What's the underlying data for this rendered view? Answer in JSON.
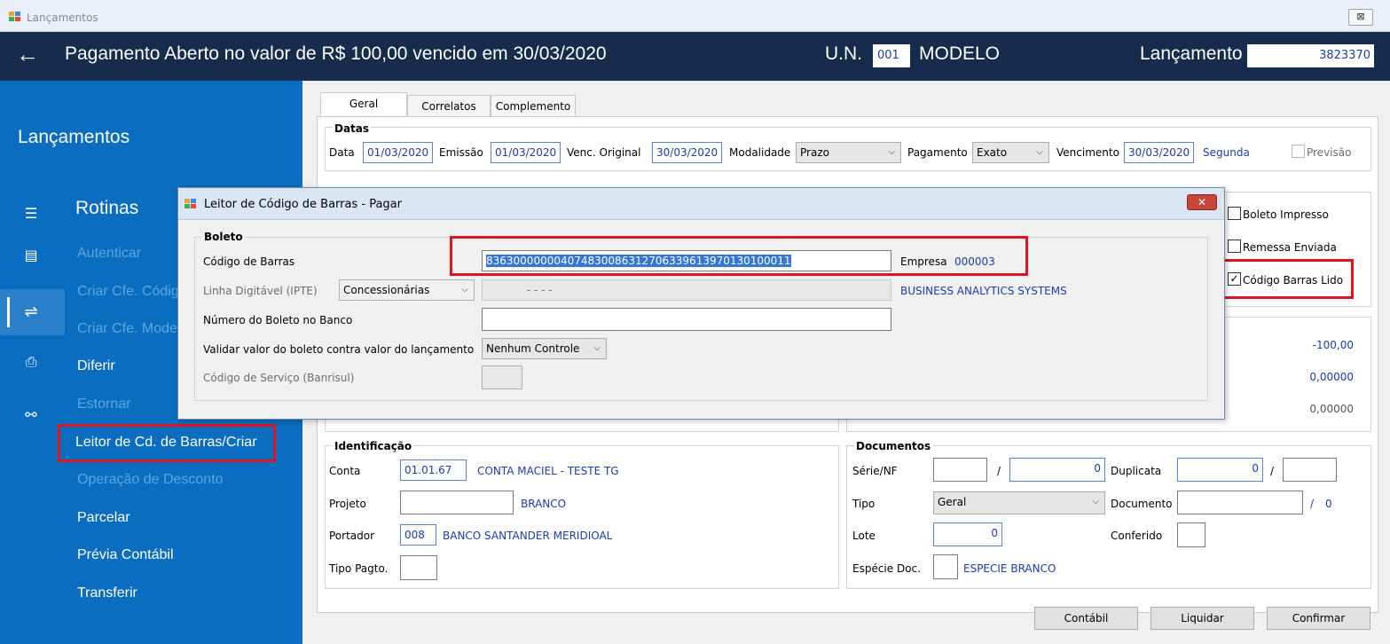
{
  "window": {
    "title": "Lançamentos",
    "close_symbol": "⊠"
  },
  "header": {
    "back_symbol": "←",
    "title": "Pagamento Aberto no valor de R$ 100,00 vencido em 30/03/2020",
    "un_label": "U.N.",
    "un_code": "001",
    "un_name": "MODELO",
    "lancamento_label": "Lançamento",
    "lancamento_value": "3823370"
  },
  "sidebar": {
    "heading": "Lançamentos",
    "rotinas_label": "Rotinas",
    "items": [
      {
        "label": "Autenticar",
        "enabled": false
      },
      {
        "label": "Criar Cfe. Códig",
        "enabled": false
      },
      {
        "label": "Criar Cfe. Mode",
        "enabled": false
      },
      {
        "label": "Diferir",
        "enabled": true
      },
      {
        "label": "Estornar",
        "enabled": false
      },
      {
        "label": "Leitor de Cd. de Barras/Criar",
        "enabled": true
      },
      {
        "label": "Operação de Desconto",
        "enabled": false
      },
      {
        "label": "Parcelar",
        "enabled": true
      },
      {
        "label": "Prévia Contábil",
        "enabled": true
      },
      {
        "label": "Transferir",
        "enabled": true
      }
    ],
    "icons": [
      "menu-icon",
      "document-icon",
      "transfer-icon",
      "printer-icon",
      "tree-icon"
    ]
  },
  "tabs": [
    "Geral",
    "Correlatos",
    "Complemento"
  ],
  "datas": {
    "legend": "Datas",
    "data_label": "Data",
    "data_value": "01/03/2020",
    "emissao_label": "Emissão",
    "emissao_value": "01/03/2020",
    "venc_original_label": "Venc. Original",
    "venc_original_value": "30/03/2020",
    "modalidade_label": "Modalidade",
    "modalidade_value": "Prazo",
    "pagamento_label": "Pagamento",
    "pagamento_value": "Exato",
    "vencimento_label": "Vencimento",
    "vencimento_value": "30/03/2020",
    "weekday": "Segunda",
    "previsao_label": "Previsão"
  },
  "flags": {
    "boleto_impresso": "Boleto Impresso",
    "remessa_enviada": "Remessa Enviada",
    "codigo_barras_lido": "Código Barras Lido"
  },
  "valores": [
    "-100,00",
    "0,00000",
    "0,00000"
  ],
  "identificacao": {
    "legend": "Identificação",
    "conta_label": "Conta",
    "conta_value": "01.01.67",
    "conta_name": "CONTA MACIEL - TESTE TG",
    "projeto_label": "Projeto",
    "projeto_name": "BRANCO",
    "portador_label": "Portador",
    "portador_value": "008",
    "portador_name": "BANCO SANTANDER MERIDIOAL",
    "tipo_pagto_label": "Tipo Pagto."
  },
  "documentos": {
    "legend": "Documentos",
    "serie_label": "Série/NF",
    "slash": "/",
    "nf_value": "0",
    "duplicata_label": "Duplicata",
    "duplicata_value": "0",
    "tipo_label": "Tipo",
    "tipo_value": "Geral",
    "documento_label": "Documento",
    "documento_suffix": "/",
    "documento_suffix_value": "0",
    "lote_label": "Lote",
    "lote_value": "0",
    "conferido_label": "Conferido",
    "especie_label": "Espécie Doc.",
    "especie_name": "ESPECIE BRANCO"
  },
  "buttons": {
    "contabil": "Contábil",
    "liquidar": "Liquidar",
    "confirmar": "Confirmar"
  },
  "dialog": {
    "title": "Leitor de Código de Barras - Pagar",
    "close_symbol": "✕",
    "group_legend": "Boleto",
    "codigo_label": "Código de Barras",
    "codigo_value": "836300000004074830086312706339613970130100011",
    "empresa_label": "Empresa",
    "empresa_value": "000003",
    "linha_label": "Linha Digitável (IPTE)",
    "linha_type": "Concessionárias",
    "linha_mask": "-          -          -          -",
    "empresa_name": "BUSINESS ANALYTICS SYSTEMS",
    "numero_label": "Número do Boleto no Banco",
    "validar_label": "Validar valor do boleto contra valor do lançamento",
    "validar_value": "Nenhum Controle",
    "servico_label": "Código de Serviço (Banrisul)"
  }
}
